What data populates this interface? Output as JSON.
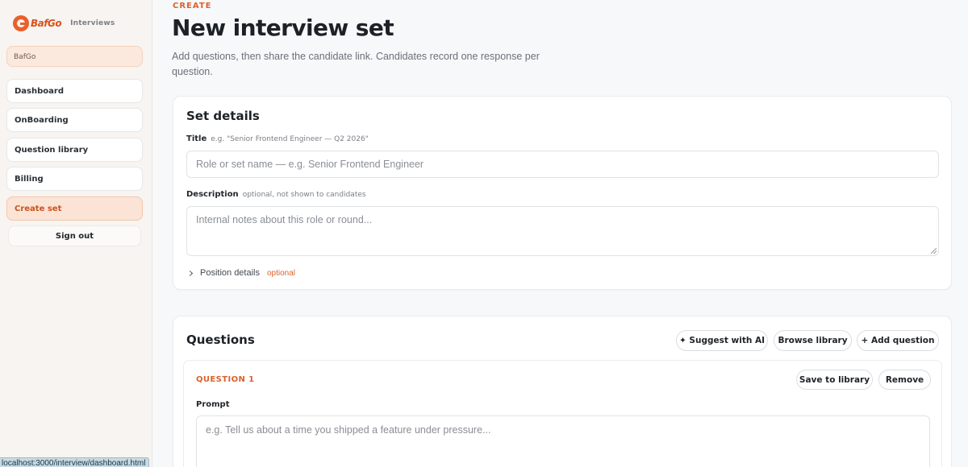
{
  "app": {
    "brand_name": "BafGo",
    "brand_sub": "Interviews",
    "brand_color": "#e8602c"
  },
  "sidebar": {
    "org": "BafGo",
    "items": [
      {
        "label": "Dashboard"
      },
      {
        "label": "OnBoarding"
      },
      {
        "label": "Question library"
      },
      {
        "label": "Billing"
      },
      {
        "label": "Create set",
        "active": true
      }
    ],
    "sign_out": "Sign out"
  },
  "page": {
    "eyebrow": "CREATE",
    "title": "New interview set",
    "description": "Add questions, then share the candidate link. Candidates record one response per question."
  },
  "set_details": {
    "title": "Set details",
    "title_field": {
      "label": "Title",
      "hint": "e.g. \"Senior Frontend Engineer — Q2 2026\"",
      "placeholder": "Role or set name — e.g. Senior Frontend Engineer"
    },
    "description_field": {
      "label": "Description",
      "hint": "optional, not shown to candidates",
      "placeholder": "Internal notes about this role or round..."
    },
    "position_details": {
      "label": "Position details",
      "tag": "optional"
    }
  },
  "questions": {
    "title": "Questions",
    "suggest_ai": "✦ Suggest with AI",
    "browse_library": "Browse library",
    "add_question": "+ Add question",
    "items": [
      {
        "label": "QUESTION 1",
        "save_to_library": "Save to library",
        "remove": "Remove",
        "prompt_label": "Prompt",
        "prompt_placeholder": "e.g. Tell us about a time you shipped a feature under pressure..."
      }
    ]
  },
  "status_bar": {
    "url": "localhost:3000/interview/dashboard.html"
  }
}
